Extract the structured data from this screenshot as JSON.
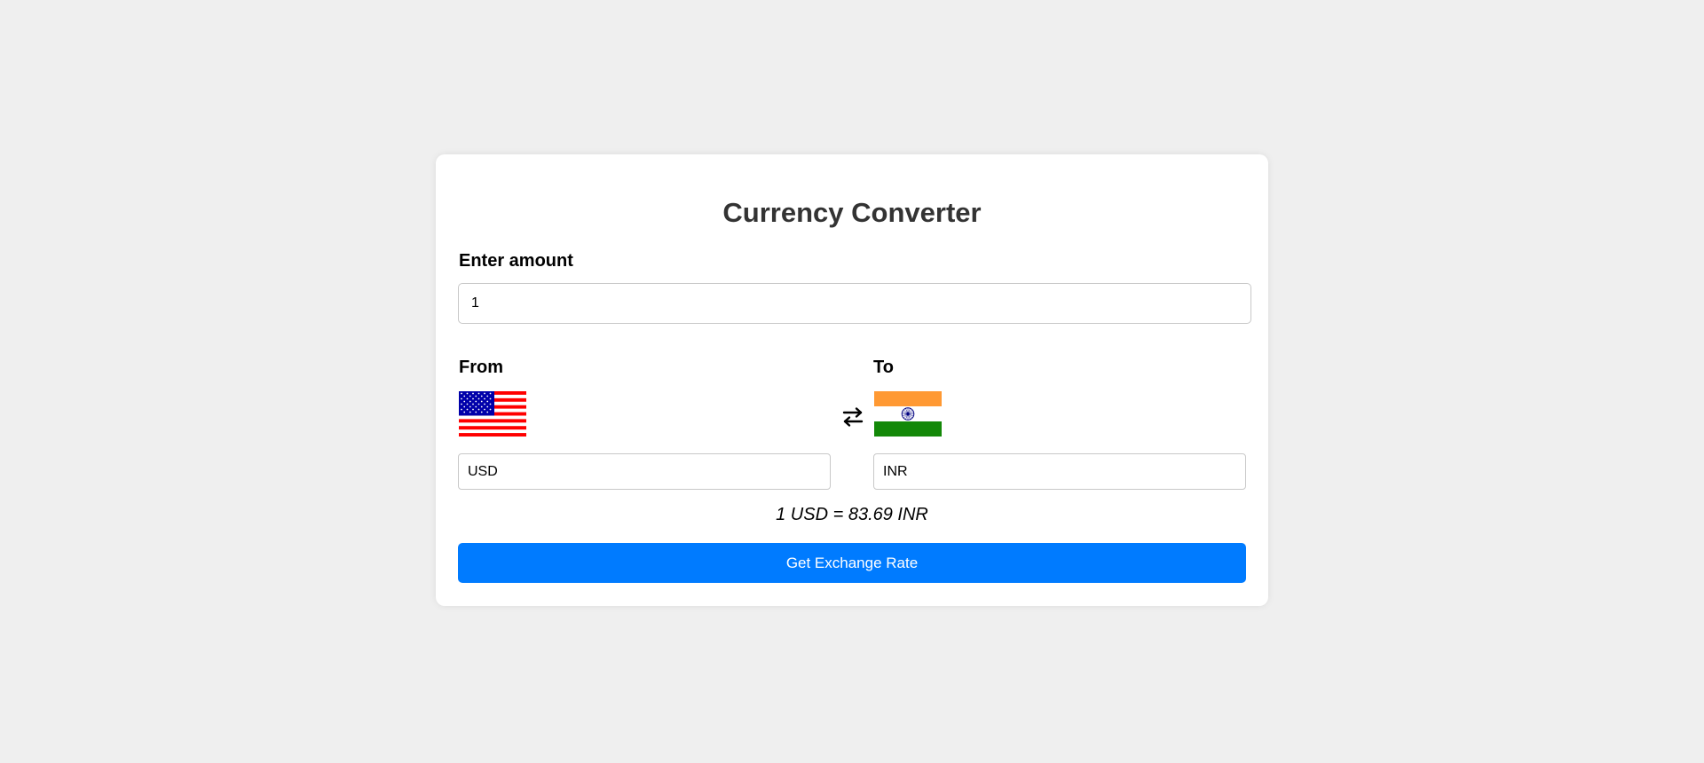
{
  "app": {
    "title": "Currency Converter"
  },
  "amount": {
    "label": "Enter amount",
    "value": "1"
  },
  "from": {
    "label": "From",
    "currency": "USD",
    "flag_icon": "us-flag-icon"
  },
  "to": {
    "label": "To",
    "currency": "INR",
    "flag_icon": "india-flag-icon"
  },
  "swap": {
    "icon": "swap-arrows-icon",
    "glyph": "⇄"
  },
  "result": {
    "text": "1 USD = 83.69 INR"
  },
  "actions": {
    "get_rate_label": "Get Exchange Rate"
  },
  "colors": {
    "background": "#efefef",
    "card": "#ffffff",
    "accent": "#007bff",
    "title": "#333333",
    "india_saffron": "#ff9933",
    "india_green": "#138808",
    "india_chakra": "#000080",
    "us_red": "#ff0000",
    "us_blue": "#0000aa"
  }
}
